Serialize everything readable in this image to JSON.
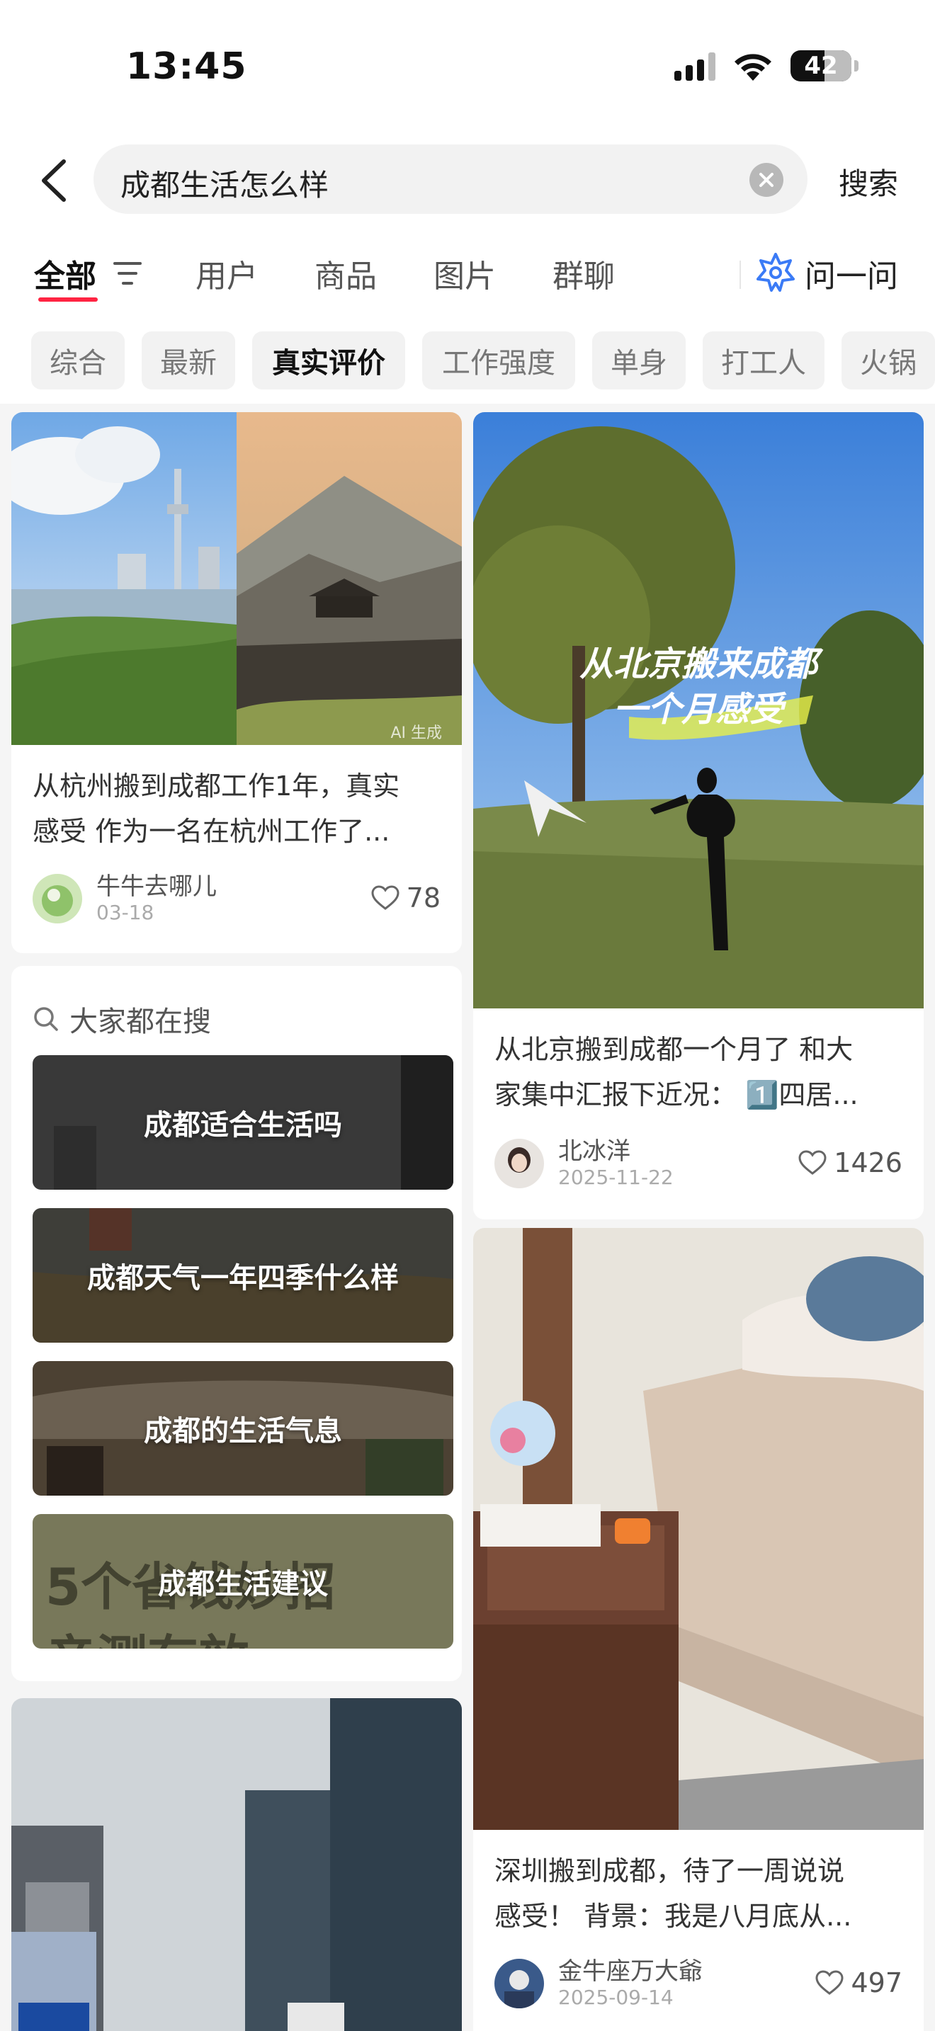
{
  "status": {
    "time": "13:45",
    "battery": "42"
  },
  "search": {
    "query": "成都生活怎么样",
    "button_label": "搜索"
  },
  "tabs": [
    {
      "label": "全部",
      "active": true
    },
    {
      "label": "用户"
    },
    {
      "label": "商品"
    },
    {
      "label": "图片"
    },
    {
      "label": "群聊"
    }
  ],
  "ask": {
    "label": "问一问"
  },
  "chips": [
    {
      "label": "综合"
    },
    {
      "label": "最新"
    },
    {
      "label": "真实评价",
      "active": true
    },
    {
      "label": "工作强度"
    },
    {
      "label": "单身"
    },
    {
      "label": "打工人"
    },
    {
      "label": "火锅"
    }
  ],
  "notes": [
    {
      "title_lines": [
        "从杭州搬到成都工作1年，真实",
        "感受 作为一名在杭州工作了..."
      ],
      "author": "牛牛去哪儿",
      "date": "03-18",
      "likes": "78",
      "image_caption": "AI 生成"
    },
    {
      "title_lines": [
        "从北京搬到成都一个月了 和大",
        "家集中汇报下近况： 1️⃣四居..."
      ],
      "author": "北冰洋",
      "date": "2025-11-22",
      "likes": "1426",
      "image_caption_lines": [
        "从北京搬来成都",
        "一个月感受"
      ]
    },
    {
      "title_lines": [
        "深圳搬到成都，待了一周说说",
        "感受！ 背景：我是八月底从..."
      ],
      "author": "金牛座万大爺",
      "date": "2025-09-14",
      "likes": "497"
    }
  ],
  "hot_searches": {
    "label": "大家都在搜",
    "items": [
      {
        "label": "成都适合生活吗"
      },
      {
        "label": "成都天气一年四季什么样"
      },
      {
        "label": "成都的生活气息"
      },
      {
        "label": "成都生活建议",
        "bg_text_lines": [
          "5个省钱妙招",
          "亲测有效"
        ]
      }
    ]
  },
  "colors": {
    "accent": "#ff2442",
    "ask_icon": "#3b7bf6"
  }
}
